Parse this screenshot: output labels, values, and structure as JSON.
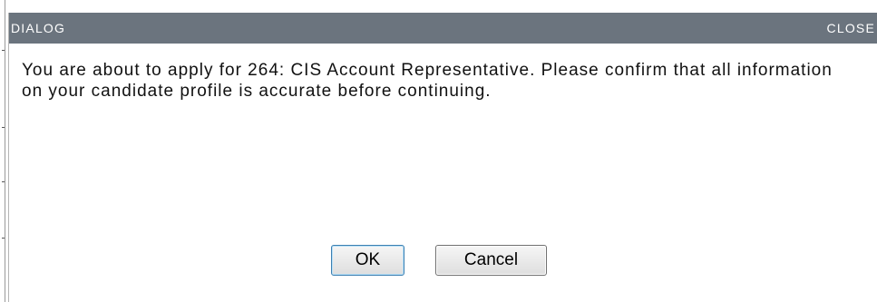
{
  "dialog": {
    "title": "DIALOG",
    "close_label": "CLOSE",
    "message": "You are about to apply for 264: CIS Account Representative. Please confirm that all information on your candidate profile is accurate before continuing.",
    "ok_label": "OK",
    "cancel_label": "Cancel"
  },
  "colors": {
    "titlebar_bg": "#6b747e",
    "titlebar_text": "#ffffff",
    "ok_focus_border": "#3c7fb1"
  }
}
